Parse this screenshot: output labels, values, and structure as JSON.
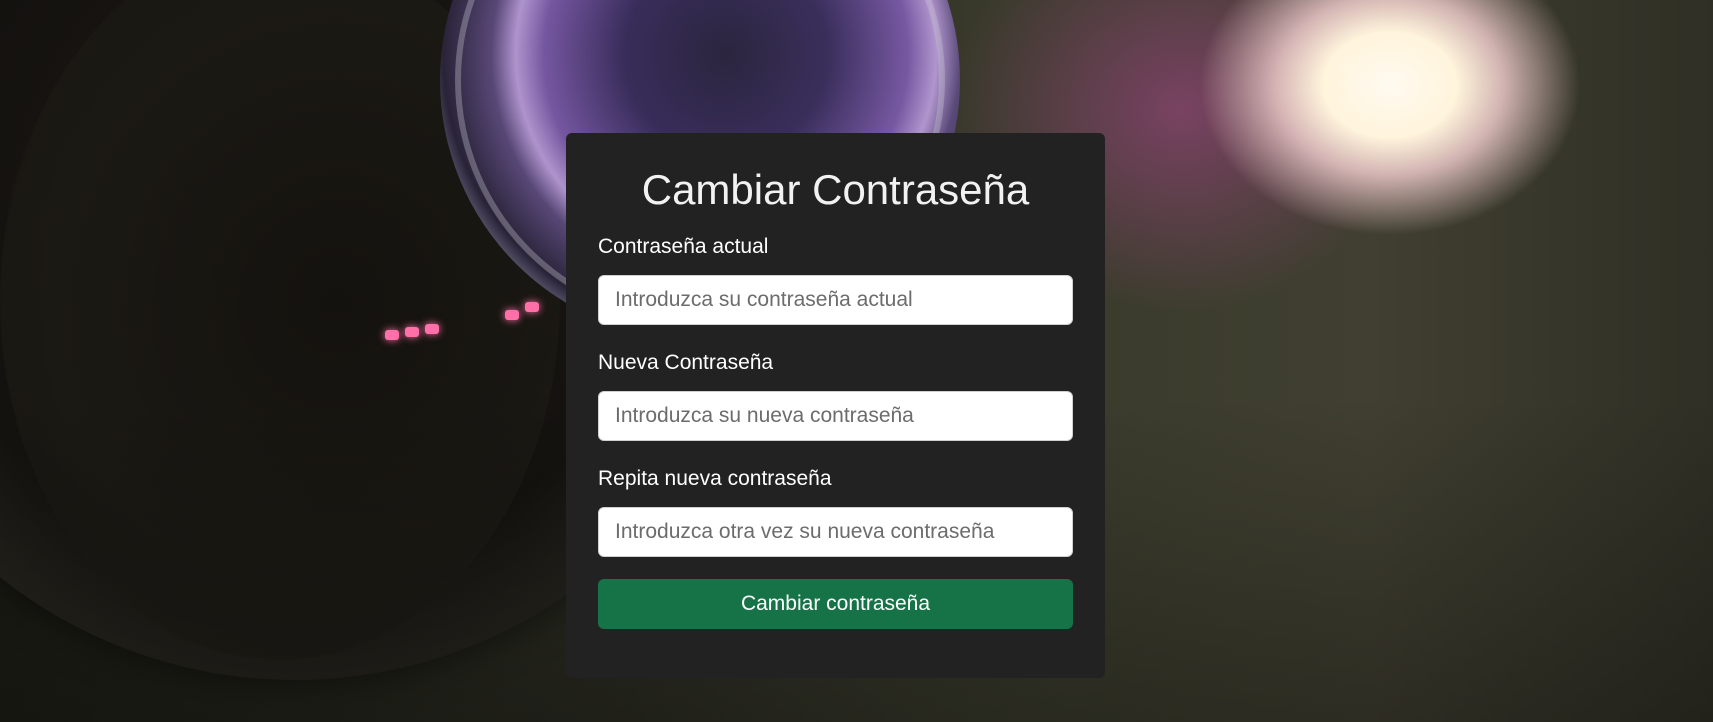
{
  "form": {
    "title": "Cambiar Contraseña",
    "fields": [
      {
        "label": "Contraseña actual",
        "placeholder": "Introduzca su contraseña actual",
        "value": ""
      },
      {
        "label": "Nueva Contraseña",
        "placeholder": "Introduzca su nueva contraseña",
        "value": ""
      },
      {
        "label": "Repita nueva contraseña",
        "placeholder": "Introduzca otra vez su nueva contraseña",
        "value": ""
      }
    ],
    "submit_label": "Cambiar contraseña"
  },
  "colors": {
    "card_background": "#222222",
    "button_background": "#157347",
    "text": "#ffffff"
  },
  "background": {
    "image": "camera-lens-background"
  }
}
